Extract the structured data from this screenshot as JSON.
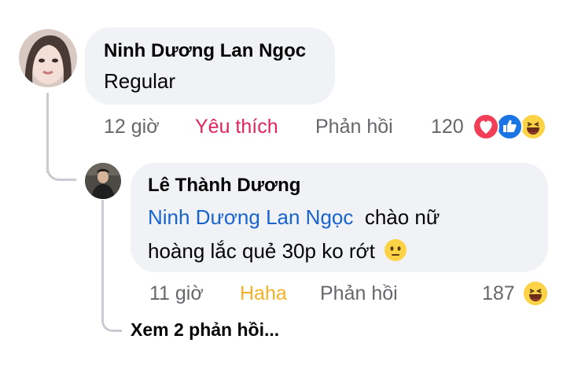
{
  "comments": [
    {
      "author": "Ninh Dương Lan Ngọc",
      "text": "Regular",
      "time": "12 giờ",
      "reaction_action": "Yêu thích",
      "reply_action": "Phản hồi",
      "reaction_count": "120",
      "reaction_icons": [
        "love-reaction-icon",
        "like-reaction-icon",
        "haha-reaction-icon"
      ]
    },
    {
      "author": "Lê Thành Dương",
      "mention": "Ninh Dương Lan Ngọc",
      "text_line1": "chào nữ",
      "text_line2": "hoàng lắc quẻ 30p ko rớt",
      "text_emoji": "neutral-face-emoji",
      "time": "11 giờ",
      "reaction_action": "Haha",
      "reply_action": "Phản hồi",
      "reaction_count": "187",
      "reaction_icons": [
        "haha-reaction-icon"
      ]
    }
  ],
  "view_replies": "Xem 2 phản hồi...",
  "colors": {
    "bubble": "#f0f2f5",
    "mention": "#1763cf",
    "love": "#e0245e",
    "haha": "#f7b125",
    "meta": "#65676b",
    "thread": "#c9ccd1"
  }
}
